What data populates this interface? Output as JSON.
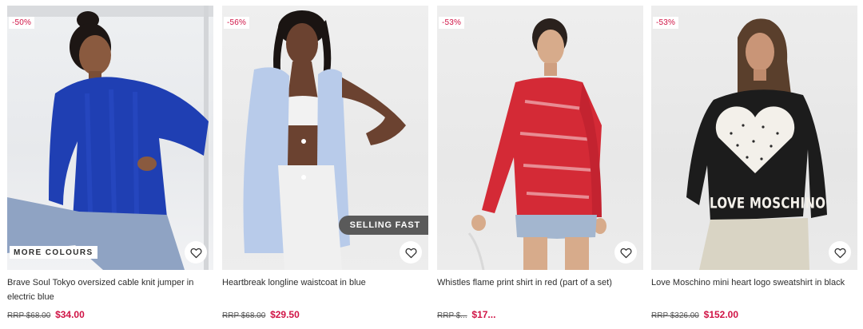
{
  "products": [
    {
      "discount": "-50%",
      "title": "Brave Soul Tokyo oversized cable knit jumper in electric blue",
      "rrp": "RRP $68.00",
      "price": "$34.00",
      "badge": "MORE COLOURS",
      "garment_color": "#1f3fb3",
      "wishlist_icon": "heart-outline-icon"
    },
    {
      "discount": "-56%",
      "title": "Heartbreak longline waistcoat in blue",
      "rrp": "RRP $68.00",
      "price": "$29.50",
      "badge": "SELLING FAST",
      "garment_color": "#b8cbea",
      "wishlist_icon": "heart-outline-icon"
    },
    {
      "discount": "-53%",
      "title": "Whistles flame print shirt in red (part of a set)",
      "rrp": "RRP $...",
      "price": "$17...",
      "badge": "",
      "garment_color": "#d42a36",
      "wishlist_icon": "heart-outline-icon"
    },
    {
      "discount": "-53%",
      "title": "Love Moschino mini heart logo sweatshirt in black",
      "rrp": "RRP $326.00",
      "price": "$152.00",
      "badge": "",
      "garment_color": "#1c1c1c",
      "wishlist_icon": "heart-outline-icon"
    }
  ],
  "graphic_text": {
    "sweatshirt_logo": "LOVE MOSCHINO"
  },
  "colors": {
    "sale_red": "#d01345",
    "badge_dark": "#5a5a5a"
  }
}
